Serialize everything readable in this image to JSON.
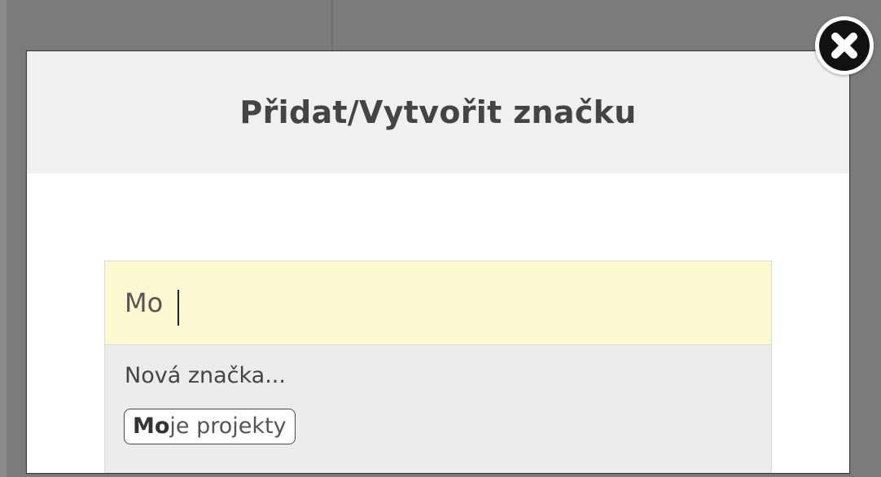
{
  "modal": {
    "title": "Přidat/Vytvořit značku"
  },
  "tag_input": {
    "value": "Mo",
    "background_color": "#fcf8cf"
  },
  "dropdown": {
    "new_tag_label": "Nová značka...",
    "suggestions": [
      {
        "match": "Mo",
        "rest": "je projekty"
      }
    ]
  },
  "close_button": {
    "icon": "close-icon"
  },
  "colors": {
    "overlay": "#7b7b7b",
    "header": "#f0f0f0",
    "title_text": "#444444",
    "dropdown": "#ececec"
  }
}
